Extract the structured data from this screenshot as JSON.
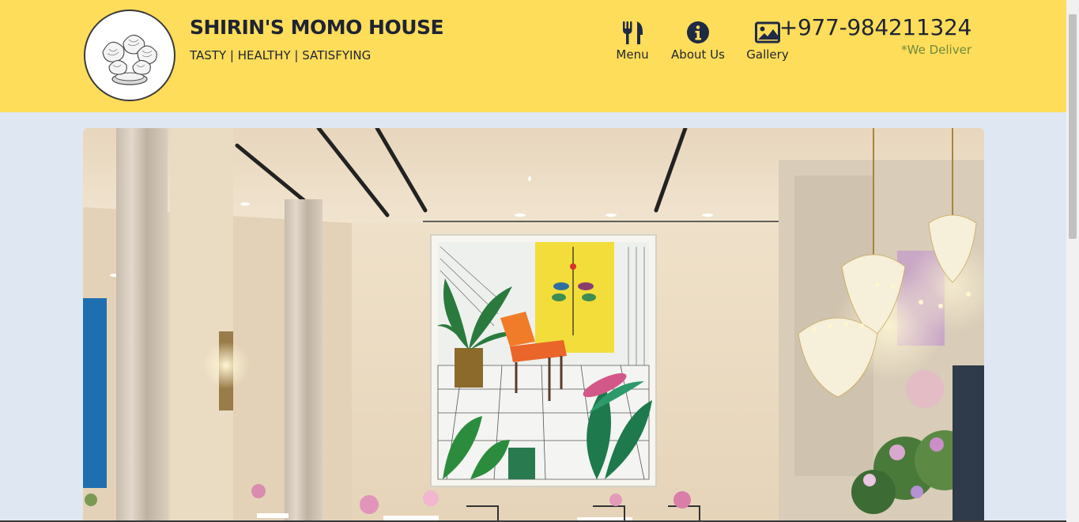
{
  "header": {
    "brand_name": "SHIRIN'S MOMO HOUSE",
    "tagline": "TASTY | HEALTHY | SATISFYING",
    "background_color": "#fedd5a"
  },
  "nav": {
    "items": [
      {
        "label": "Menu",
        "icon": "utensils-icon"
      },
      {
        "label": "About Us",
        "icon": "info-circle-icon"
      },
      {
        "label": "Gallery",
        "icon": "image-icon"
      }
    ]
  },
  "contact": {
    "phone": "+977-984211324",
    "delivery_note": "*We Deliver"
  },
  "hero": {
    "image": "restaurant-interior-photo"
  },
  "colors": {
    "page_background": "#dfe8f2",
    "text_dark": "#1f2433",
    "delivery_green": "#6f8a3c"
  }
}
